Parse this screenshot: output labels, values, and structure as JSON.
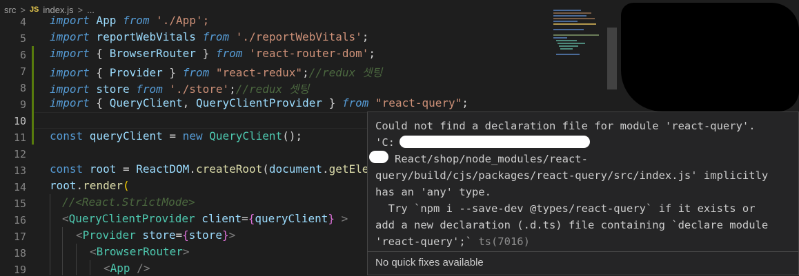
{
  "breadcrumb": {
    "folder": "src",
    "sep": ">",
    "js_badge": "JS",
    "file": "index.js",
    "more": "..."
  },
  "gutter": {
    "lines": [
      "4",
      "5",
      "6",
      "7",
      "8",
      "9",
      "10",
      "11",
      "12",
      "13",
      "14",
      "15",
      "16",
      "17",
      "18",
      "19"
    ],
    "active": "10"
  },
  "code": {
    "l4": {
      "a": "import",
      "b": " App ",
      "c": "from",
      "d": " './App';"
    },
    "l5": {
      "a": "import",
      "b": " reportWebVitals ",
      "c": "from",
      "d": " './reportWebVitals'",
      "e": ";"
    },
    "l6": {
      "a": "import",
      "b": " { ",
      "c": "BrowserRouter",
      "d": " } ",
      "e": "from",
      "f": " 'react-router-dom'",
      "g": ";"
    },
    "l7": {
      "a": "import",
      "b": " { ",
      "c": "Provider",
      "d": " } ",
      "e": "from",
      "f": " \"react-redux\"",
      "g": ";",
      "h": "//redux 셋팅"
    },
    "l8": {
      "a": "import",
      "b": " store ",
      "c": "from",
      "d": " './store'",
      "e": ";",
      "f": "//redux 셋팅"
    },
    "l9": {
      "a": "import",
      "b": " { ",
      "c": "QueryClient",
      "d": ", ",
      "e": "QueryClientProvider",
      "f": " } ",
      "g": "from",
      "h": " \"react-query\"",
      "i": ";"
    },
    "l11": {
      "a": "const",
      "b": " queryClient ",
      "c": "=",
      "d": " new ",
      "e": "QueryClient",
      "f": "();"
    },
    "l13": {
      "a": "const",
      "b": " root ",
      "c": "= ",
      "d": "ReactDOM",
      "e": ".",
      "f": "createRoot",
      "g": "(",
      "h": "document",
      "i": ".",
      "j": "getEle"
    },
    "l14": {
      "a": "root",
      "b": ".",
      "c": "render",
      "d": "("
    },
    "l15": {
      "a": "//<React.StrictMode>"
    },
    "l16": {
      "a": "<",
      "b": "QueryClientProvider",
      "c": " client",
      "d": "=",
      "e": "{",
      "f": "queryClient",
      "g": "}",
      "h": " >"
    },
    "l17": {
      "a": "<",
      "b": "Provider",
      "c": " store",
      "d": "=",
      "e": "{",
      "f": "store",
      "g": "}",
      "h": ">"
    },
    "l18": {
      "a": "<",
      "b": "BrowserRouter",
      "c": ">"
    },
    "l19": {
      "a": "<",
      "b": "App",
      "c": " />"
    }
  },
  "tooltip": {
    "line1": "Could not find a declaration file for module 'react-query'.",
    "line2": "'C:",
    "line3": "   React/shop/node_modules/react-",
    "line4": "query/build/cjs/packages/react-query/src/index.js' implicitly",
    "line5": "has an 'any' type.",
    "line6": "  Try `npm i --save-dev @types/react-query` if it exists or",
    "line7": "add a new declaration (.d.ts) file containing `declare module",
    "line8": "'react-query';`",
    "code": " ts(7016)",
    "footer": "No quick fixes available"
  }
}
